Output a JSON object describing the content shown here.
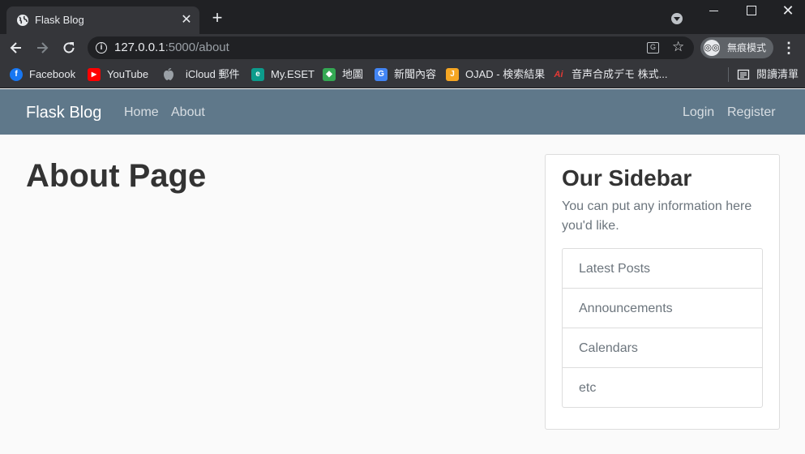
{
  "browser": {
    "tab": {
      "title": "Flask Blog",
      "close": "✕"
    },
    "new_tab": "+",
    "window": {
      "close": "✕"
    },
    "url": {
      "host": "127.0.0.1",
      "path": ":5000/about"
    },
    "translate_glyph": "G",
    "incognito": {
      "label": "無痕模式",
      "icon": "◎◎"
    },
    "bookmarks": [
      {
        "label": "Facebook",
        "icon": "facebook-icon",
        "glyph": "f",
        "color": "#1877f2"
      },
      {
        "label": "YouTube",
        "icon": "youtube-icon",
        "glyph": "▶",
        "color": "#ff0000"
      },
      {
        "label": "iCloud 郵件",
        "icon": "apple-icon",
        "glyph": "",
        "color": "#9aa0a6"
      },
      {
        "label": "My.ESET",
        "icon": "eset-icon",
        "glyph": "e",
        "color": "#0c9c8c"
      },
      {
        "label": "地圖",
        "icon": "maps-icon",
        "glyph": "◆",
        "color": "#34a853"
      },
      {
        "label": "新聞內容",
        "icon": "news-icon",
        "glyph": "G",
        "color": "#4285f4"
      },
      {
        "label": "OJAD - 検索結果",
        "icon": "ojad-icon",
        "glyph": "J",
        "color": "#f5a623"
      },
      {
        "label": "音声合成デモ 株式...",
        "icon": "ai-icon",
        "glyph": "Ai",
        "color": "#e53935"
      }
    ],
    "reading_list": "閱讀清單"
  },
  "navbar": {
    "brand": "Flask Blog",
    "links": [
      "Home",
      "About"
    ],
    "right_links": [
      "Login",
      "Register"
    ]
  },
  "main": {
    "title": "About Page"
  },
  "sidebar": {
    "title": "Our Sidebar",
    "text": "You can put any information here you'd like.",
    "items": [
      "Latest Posts",
      "Announcements",
      "Calendars",
      "etc"
    ]
  }
}
